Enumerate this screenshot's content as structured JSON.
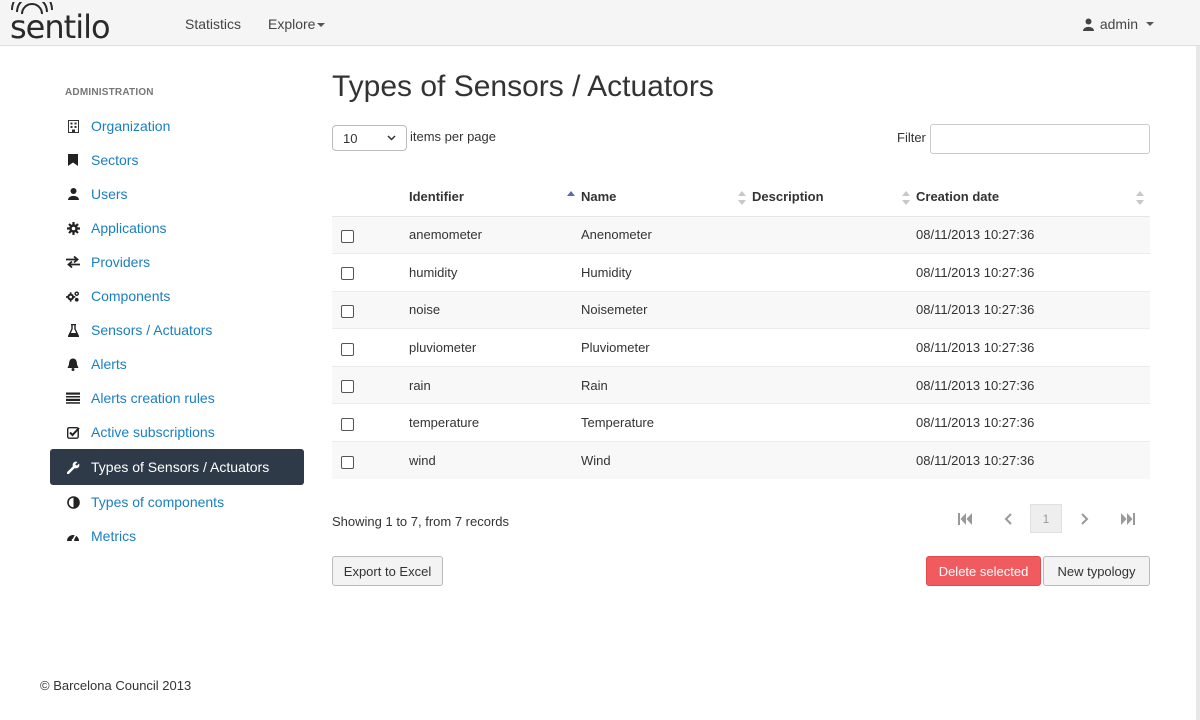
{
  "brand": {
    "name": "sentilo"
  },
  "nav": {
    "statistics": "Statistics",
    "explore": "Explore",
    "user": "admin"
  },
  "sidebar": {
    "heading": "ADMINISTRATION",
    "items": [
      {
        "label": "Organization",
        "icon": "building-icon"
      },
      {
        "label": "Sectors",
        "icon": "bookmark-icon"
      },
      {
        "label": "Users",
        "icon": "user-icon"
      },
      {
        "label": "Applications",
        "icon": "gear-icon"
      },
      {
        "label": "Providers",
        "icon": "exchange-icon"
      },
      {
        "label": "Components",
        "icon": "gears-icon"
      },
      {
        "label": "Sensors / Actuators",
        "icon": "flask-icon"
      },
      {
        "label": "Alerts",
        "icon": "bell-icon"
      },
      {
        "label": "Alerts creation rules",
        "icon": "list-icon"
      },
      {
        "label": "Active subscriptions",
        "icon": "check-square-icon"
      },
      {
        "label": "Types of Sensors / Actuators",
        "icon": "wrench-icon",
        "active": true
      },
      {
        "label": "Types of components",
        "icon": "adjust-icon"
      },
      {
        "label": "Metrics",
        "icon": "dashboard-icon"
      }
    ]
  },
  "main": {
    "title": "Types of Sensors / Actuators",
    "per_page_value": "10",
    "per_page_label": "items per page",
    "filter_label": "Filter",
    "filter_value": "",
    "columns": [
      "Identifier",
      "Name",
      "Description",
      "Creation date"
    ],
    "sorted_column": "Identifier",
    "rows": [
      {
        "identifier": "anemometer",
        "name": "Anenometer",
        "description": "",
        "date": "08/11/2013 10:27:36"
      },
      {
        "identifier": "humidity",
        "name": "Humidity",
        "description": "",
        "date": "08/11/2013 10:27:36"
      },
      {
        "identifier": "noise",
        "name": "Noisemeter",
        "description": "",
        "date": "08/11/2013 10:27:36"
      },
      {
        "identifier": "pluviometer",
        "name": "Pluviometer",
        "description": "",
        "date": "08/11/2013 10:27:36"
      },
      {
        "identifier": "rain",
        "name": "Rain",
        "description": "",
        "date": "08/11/2013 10:27:36"
      },
      {
        "identifier": "temperature",
        "name": "Temperature",
        "description": "",
        "date": "08/11/2013 10:27:36"
      },
      {
        "identifier": "wind",
        "name": "Wind",
        "description": "",
        "date": "08/11/2013 10:27:36"
      }
    ],
    "showing": "Showing 1 to 7, from 7 records",
    "current_page": "1",
    "export_button": "Export to Excel",
    "delete_button": "Delete selected",
    "new_button": "New typology"
  },
  "footer": {
    "copyright": "© Barcelona Council 2013"
  },
  "colors": {
    "link": "#1a7fc0",
    "active_bg": "#2e3a48",
    "danger": "#f05b5f",
    "sort_active": "#5b6bb0"
  }
}
